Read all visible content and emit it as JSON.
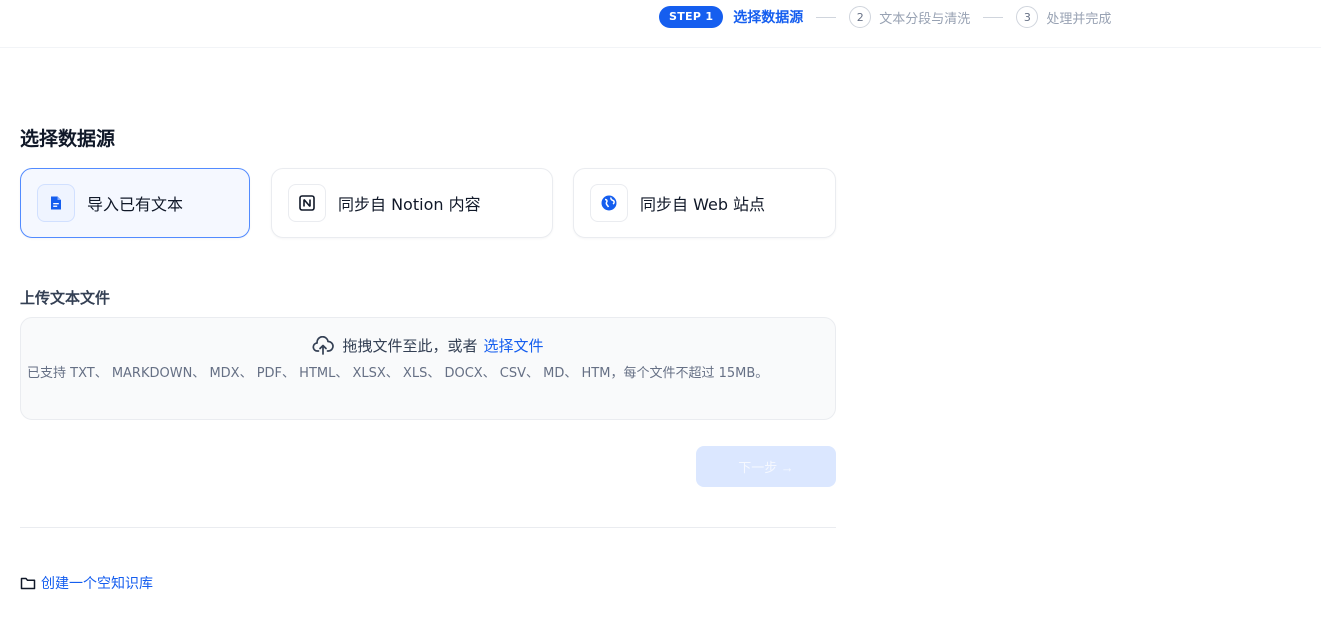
{
  "stepper": {
    "active_badge": "STEP 1",
    "active_label": "选择数据源",
    "step2_num": "2",
    "step2_label": "文本分段与清洗",
    "step3_num": "3",
    "step3_label": "处理并完成"
  },
  "page_title": "选择数据源",
  "sources": [
    {
      "label": "导入已有文本",
      "icon": "document-icon",
      "selected": true
    },
    {
      "label": "同步自 Notion 内容",
      "icon": "notion-icon",
      "selected": false
    },
    {
      "label": "同步自 Web 站点",
      "icon": "web-icon",
      "selected": false
    }
  ],
  "upload": {
    "title": "上传文本文件",
    "drag_text": "拖拽文件至此，或者",
    "select_link": "选择文件",
    "support_text": "已支持 TXT、 MARKDOWN、 MDX、 PDF、 HTML、 XLSX、 XLS、 DOCX、 CSV、 MD、 HTM，每个文件不超过 15MB。"
  },
  "next_button": {
    "label": "下一步 →",
    "disabled": true
  },
  "empty_kb_link": "创建一个空知识库",
  "colors": {
    "accent": "#155eef",
    "selected_border": "#528bff",
    "selected_bg": "#f5f8ff",
    "disabled_btn": "#dbe7ff"
  }
}
